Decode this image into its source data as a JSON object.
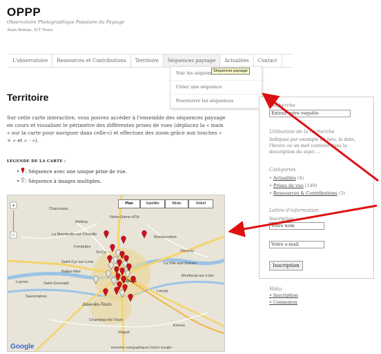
{
  "site": {
    "title": "OPPP",
    "description": "Observatoire Photographique Populaire du Paysage",
    "author": "Alain Beblan, IUT Tours"
  },
  "nav": {
    "items": [
      {
        "label": "L'observatoire"
      },
      {
        "label": "Ressources et Contributions"
      },
      {
        "label": "Territoire"
      },
      {
        "label": "Séquences paysage"
      },
      {
        "label": "Actualités"
      },
      {
        "label": "Contact"
      }
    ],
    "dropdown": [
      {
        "label": "Voir les séquences"
      },
      {
        "label": "Créer une séquence"
      },
      {
        "label": "Poursuivre les séquences"
      }
    ],
    "tooltip": "Séquences paysage"
  },
  "main": {
    "title": "Territoire",
    "intro": "Sur cette carte interactive, vous pouvez accéder à l'ensemble des séquences paysage en cours et visualiser le périmètre des différentes prises de vues (déplacez la « main » sur la carte pour naviguer dans celle-ci et effectuez des zoom grâce aux touches « + » et « - »).",
    "legend_title": "LEGENDE DE LA CARTE :",
    "legend": [
      {
        "label": ": Séquence avec une unique prise de vue."
      },
      {
        "label": ": Séquence à images multiples."
      }
    ]
  },
  "map": {
    "buttons": [
      "Plan",
      "Satellite",
      "Mixte",
      "Relief"
    ],
    "zoom_in": "+",
    "zoom_out": "−",
    "footer": "Données cartographiques ©2012 Google -",
    "google": "Google",
    "places": [
      "Chanceaux",
      "Notre-Dame-d'Oé",
      "Mettray",
      "La Membrolle-sur-Choisille",
      "Rochecorbon",
      "Fondettes",
      "St-Cyr",
      "Saint-Cyr-sur-Loire",
      "La Ville-aux-Dames",
      "Tours",
      "Ballan-Miré",
      "Joué-lès-Tours",
      "Chambray-lès-Tours",
      "Savonnières",
      "Luynes",
      "Saint-Genouph",
      "Vouvray",
      "Montlouis-sur-Loire",
      "Esvres",
      "Veigné",
      "Larçay"
    ]
  },
  "sidebar": {
    "search_head": "Recherche",
    "search_placeholder": "Entrez votre requête",
    "usage_head": "Utilisation de la recherche",
    "usage_text": "Indiquez par exemple un lieu, la date, l'heure ou un mot contenu dans la description du sujet ...",
    "categories_head": "Catégories",
    "categories": [
      {
        "label": "Actualités",
        "count": "(4)"
      },
      {
        "label": "Prises de vue",
        "count": "(149)"
      },
      {
        "label": "Ressources & Contributions",
        "count": "(5)"
      }
    ],
    "newsletter_head": "Lettre d'information",
    "newsletter_label": "Inscription",
    "name_value": "Votre nom",
    "email_value": "Votre e-mail",
    "subscribe_label": "Inscription"
  },
  "meta": {
    "head": "Méta",
    "links": [
      "Inscription",
      "Connexion"
    ]
  },
  "colors": {
    "arrow": "#dd1111",
    "pin": "#cc1122",
    "map_road": "#f5d36b",
    "map_water": "#9bc3e6",
    "map_bg": "#e8e4d8"
  }
}
